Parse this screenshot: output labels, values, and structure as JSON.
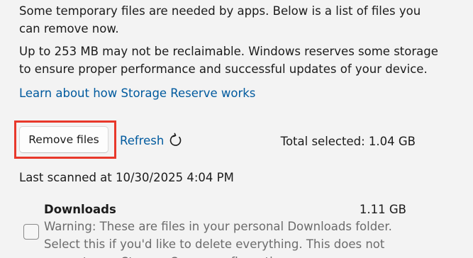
{
  "intro_text": "Some temporary files are needed by apps. Below is a list of files you can remove now.",
  "reserve_text": "Up to 253 MB may not be reclaimable. Windows reserves some storage to ensure proper performance and successful updates of your device.",
  "learn_link": "Learn about how Storage Reserve works",
  "actions": {
    "remove_label": "Remove files",
    "refresh_label": "Refresh",
    "refresh_icon": "refresh-icon",
    "highlight_color": "#e8382b"
  },
  "total_selected": "Total selected: 1.04 GB",
  "last_scanned": "Last scanned at 10/30/2025 4:04 PM",
  "items": [
    {
      "title": "Downloads",
      "size": "1.11 GB",
      "checked": false,
      "description": "Warning: These are files in your personal Downloads folder. Select this if you'd like to delete everything. This does not respect your Storage Sense configuration."
    }
  ]
}
